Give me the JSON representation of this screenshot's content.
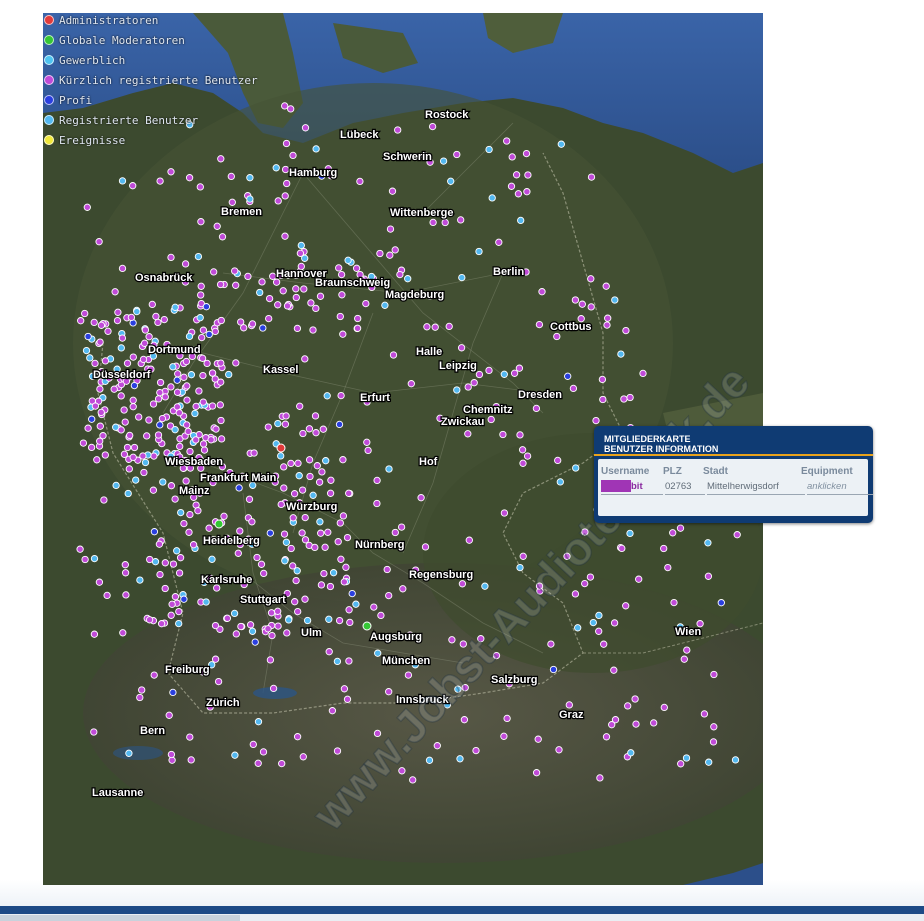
{
  "legend": {
    "items": [
      {
        "label": "Administratoren",
        "color": "#e23a3a"
      },
      {
        "label": "Globale Moderatoren",
        "color": "#35c635"
      },
      {
        "label": "Gewerblich",
        "color": "#4ec3f0"
      },
      {
        "label": "Kürzlich registrierte Benutzer",
        "color": "#c04ad8"
      },
      {
        "label": "Profi",
        "color": "#2a3fe0"
      },
      {
        "label": "Registrierte Benutzer",
        "color": "#53b8f0"
      },
      {
        "label": "Ereignisse",
        "color": "#f0e83a"
      }
    ]
  },
  "map": {
    "cities": [
      "Rostock",
      "Lübeck",
      "Schwerin",
      "Hamburg",
      "Bremen",
      "Wittenberge",
      "Berlin",
      "Osnabrück",
      "Hannover",
      "Braunschweig",
      "Magdeburg",
      "Cottbus",
      "Dortmund",
      "Halle",
      "Kassel",
      "Leipzig",
      "Düsseldorf",
      "Erfurt",
      "Dresden",
      "Chemnitz",
      "Zwickau",
      "Wiesbaden",
      "Hof",
      "Frankfurt Main",
      "Mainz",
      "Würzburg",
      "Heidelberg",
      "Nürnberg",
      "Regensburg",
      "Karlsruhe",
      "Stuttgart",
      "Ulm",
      "Augsburg",
      "Wien",
      "München",
      "Freiburg",
      "Salzburg",
      "Zürich",
      "Innsbruck",
      "Graz",
      "Bern",
      "Lausanne"
    ],
    "watermark": "www.Jobst-Audiotechnik.de"
  },
  "info_panel": {
    "title_line1": "MITGLIEDERKARTE",
    "title_line2": "BENUTZER INFORMATION",
    "headers": {
      "username": "Username",
      "plz": "PLZ",
      "stadt": "Stadt",
      "equipment": "Equipment"
    },
    "row": {
      "username": "bit",
      "plz": "02763",
      "stadt": "Mittelherwigsdorf",
      "equipment": "anklicken"
    }
  }
}
